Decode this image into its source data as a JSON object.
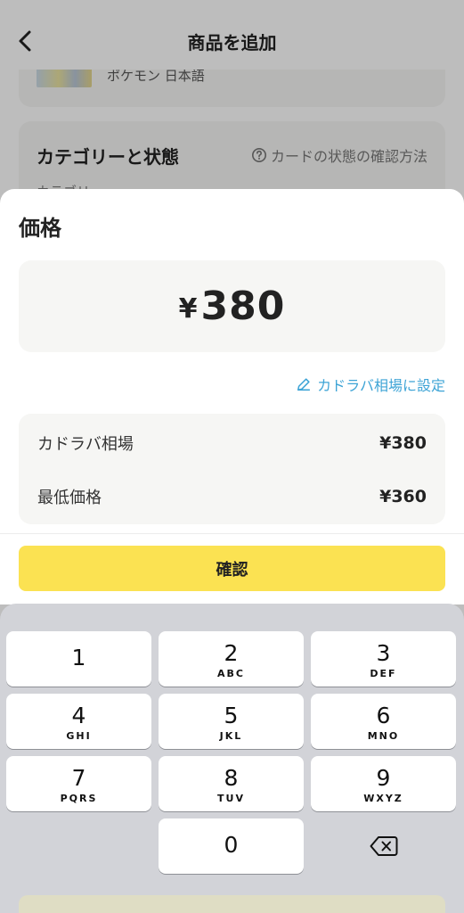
{
  "nav": {
    "title": "商品を追加",
    "back_icon": "chevron-left-icon"
  },
  "background": {
    "card_label": "ポケモン 日本語",
    "section_title": "カテゴリーと状態",
    "help_link": "カードの状態の確認方法",
    "sub_label": "カテゴリ"
  },
  "sheet": {
    "title": "価格",
    "currency": "¥",
    "amount": "380",
    "set_market_link": "カドラバ相場に設定",
    "info": [
      {
        "label": "カドラバ相場",
        "value": "¥380"
      },
      {
        "label": "最低価格",
        "value": "¥360"
      }
    ],
    "confirm_label": "確認"
  },
  "keypad": {
    "keys": [
      {
        "num": "1",
        "letters": ""
      },
      {
        "num": "2",
        "letters": "ABC"
      },
      {
        "num": "3",
        "letters": "DEF"
      },
      {
        "num": "4",
        "letters": "GHI"
      },
      {
        "num": "5",
        "letters": "JKL"
      },
      {
        "num": "6",
        "letters": "MNO"
      },
      {
        "num": "7",
        "letters": "PQRS"
      },
      {
        "num": "8",
        "letters": "TUV"
      },
      {
        "num": "9",
        "letters": "WXYZ"
      },
      {
        "num": "0",
        "letters": ""
      }
    ],
    "delete_icon": "backspace-icon"
  },
  "colors": {
    "accent": "#fbe252",
    "link": "#3ea4d6",
    "keypad_bg": "#d2d3d8"
  }
}
